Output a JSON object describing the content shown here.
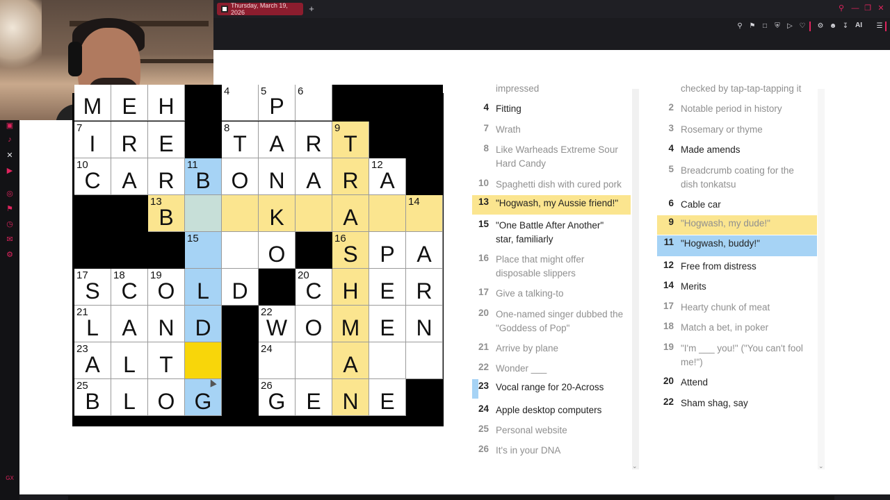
{
  "browser": {
    "tab_title": "Thursday, March 19, 2026",
    "new_tab_symbol": "+",
    "ai_label": "AI",
    "sidebar_icons": [
      "instagram-icon",
      "tiktok-icon",
      "x-icon",
      "youtube-icon",
      "player-icon",
      "pin-icon",
      "clock-icon",
      "chat-icon",
      "settings-icon"
    ],
    "sidebar_footer": "GX",
    "accent_color": "#e0245e"
  },
  "grid": {
    "rows": [
      [
        {
          "l": "M",
          "s": "w"
        },
        {
          "l": "E",
          "s": "w"
        },
        {
          "l": "H",
          "s": "w"
        },
        {
          "s": "b"
        },
        {
          "n": "4",
          "s": "w"
        },
        {
          "n": "5",
          "l": "P",
          "s": "w"
        },
        {
          "n": "6",
          "s": "w"
        },
        {
          "s": "b"
        },
        {
          "s": "b"
        },
        {
          "s": "b"
        }
      ],
      [
        {
          "n": "7",
          "l": "I",
          "s": "w"
        },
        {
          "l": "R",
          "s": "w"
        },
        {
          "l": "E",
          "s": "w"
        },
        {
          "s": "b"
        },
        {
          "n": "8",
          "l": "T",
          "s": "w"
        },
        {
          "l": "A",
          "s": "w"
        },
        {
          "l": "R",
          "s": "w"
        },
        {
          "n": "9",
          "l": "T",
          "s": "y"
        },
        {
          "s": "b"
        },
        {
          "s": "b"
        }
      ],
      [
        {
          "n": "10",
          "l": "C",
          "s": "w"
        },
        {
          "l": "A",
          "s": "w"
        },
        {
          "l": "R",
          "s": "w"
        },
        {
          "n": "11",
          "l": "B",
          "s": "u"
        },
        {
          "l": "O",
          "s": "w"
        },
        {
          "l": "N",
          "s": "w"
        },
        {
          "l": "A",
          "s": "w"
        },
        {
          "l": "R",
          "s": "y"
        },
        {
          "n": "12",
          "l": "A",
          "s": "w"
        },
        {
          "s": "b"
        }
      ],
      [
        {
          "s": "b"
        },
        {
          "s": "b"
        },
        {
          "n": "13",
          "l": "B",
          "s": "y"
        },
        {
          "s": "g"
        },
        {
          "s": "y"
        },
        {
          "l": "K",
          "s": "y"
        },
        {
          "s": "y"
        },
        {
          "l": "A",
          "s": "y"
        },
        {
          "s": "y"
        },
        {
          "n": "14",
          "s": "y"
        }
      ],
      [
        {
          "s": "b"
        },
        {
          "s": "b"
        },
        {
          "s": "b"
        },
        {
          "n": "15",
          "s": "u"
        },
        {
          "s": "w"
        },
        {
          "l": "O",
          "s": "w"
        },
        {
          "s": "b"
        },
        {
          "n": "16",
          "l": "S",
          "s": "y"
        },
        {
          "l": "P",
          "s": "w"
        },
        {
          "l": "A",
          "s": "w"
        }
      ],
      [
        {
          "n": "17",
          "l": "S",
          "s": "w"
        },
        {
          "n": "18",
          "l": "C",
          "s": "w"
        },
        {
          "n": "19",
          "l": "O",
          "s": "w"
        },
        {
          "l": "L",
          "s": "u"
        },
        {
          "l": "D",
          "s": "w"
        },
        {
          "s": "b"
        },
        {
          "n": "20",
          "l": "C",
          "s": "w"
        },
        {
          "l": "H",
          "s": "y"
        },
        {
          "l": "E",
          "s": "w"
        },
        {
          "l": "R",
          "s": "w"
        }
      ],
      [
        {
          "n": "21",
          "l": "L",
          "s": "w"
        },
        {
          "l": "A",
          "s": "w"
        },
        {
          "l": "N",
          "s": "w"
        },
        {
          "l": "D",
          "s": "u"
        },
        {
          "s": "b"
        },
        {
          "n": "22",
          "l": "W",
          "s": "w"
        },
        {
          "l": "O",
          "s": "w"
        },
        {
          "l": "M",
          "s": "y"
        },
        {
          "l": "E",
          "s": "w"
        },
        {
          "l": "N",
          "s": "w"
        }
      ],
      [
        {
          "n": "23",
          "l": "A",
          "s": "w"
        },
        {
          "l": "L",
          "s": "w"
        },
        {
          "l": "T",
          "s": "w"
        },
        {
          "s": "c"
        },
        {
          "s": "b"
        },
        {
          "n": "24",
          "s": "w"
        },
        {
          "s": "w"
        },
        {
          "l": "A",
          "s": "y"
        },
        {
          "s": "w"
        },
        {
          "s": "w"
        }
      ],
      [
        {
          "n": "25",
          "l": "B",
          "s": "w"
        },
        {
          "l": "L",
          "s": "w"
        },
        {
          "l": "O",
          "s": "w"
        },
        {
          "l": "G",
          "s": "u"
        },
        {
          "s": "b"
        },
        {
          "n": "26",
          "l": "G",
          "s": "w"
        },
        {
          "l": "E",
          "s": "w"
        },
        {
          "l": "N",
          "s": "y"
        },
        {
          "l": "E",
          "s": "w"
        },
        {
          "s": "b"
        }
      ]
    ]
  },
  "across": [
    {
      "n": "",
      "t": "impressed",
      "st": "dim"
    },
    {
      "n": "4",
      "t": "Fitting",
      "st": "normal"
    },
    {
      "n": "7",
      "t": "Wrath",
      "st": "dim"
    },
    {
      "n": "8",
      "t": "Like Warheads Extreme Sour Hard Candy",
      "st": "dim"
    },
    {
      "n": "10",
      "t": "Spaghetti dish with cured pork",
      "st": "dim"
    },
    {
      "n": "13",
      "t": "\"Hogwash, my Aussie friend!\"",
      "st": "active"
    },
    {
      "n": "15",
      "t": "\"One Battle After Another\" star, familiarly",
      "st": "normal"
    },
    {
      "n": "16",
      "t": "Place that might offer disposable slippers",
      "st": "dim"
    },
    {
      "n": "17",
      "t": "Give a talking-to",
      "st": "dim"
    },
    {
      "n": "20",
      "t": "One-named singer dubbed the \"Goddess of Pop\"",
      "st": "dim"
    },
    {
      "n": "21",
      "t": "Arrive by plane",
      "st": "dim"
    },
    {
      "n": "22",
      "t": "Wonder ___",
      "st": "dim"
    },
    {
      "n": "23",
      "t": "Vocal range for 20-Across",
      "st": "marked"
    },
    {
      "n": "24",
      "t": "Apple desktop computers",
      "st": "normal"
    },
    {
      "n": "25",
      "t": "Personal website",
      "st": "dim"
    },
    {
      "n": "26",
      "t": "It's in your DNA",
      "st": "dim"
    }
  ],
  "down": [
    {
      "n": "",
      "t": "checked by tap-tap-tapping it",
      "st": "dim"
    },
    {
      "n": "2",
      "t": "Notable period in history",
      "st": "dim"
    },
    {
      "n": "3",
      "t": "Rosemary or thyme",
      "st": "dim"
    },
    {
      "n": "4",
      "t": "Made amends",
      "st": "normal"
    },
    {
      "n": "5",
      "t": "Breadcrumb coating for the dish tonkatsu",
      "st": "dim"
    },
    {
      "n": "6",
      "t": "Cable car",
      "st": "normal"
    },
    {
      "n": "9",
      "t": "\"Hogwash, my dude!\"",
      "st": "active-dim"
    },
    {
      "n": "11",
      "t": "\"Hogwash, buddy!\"",
      "st": "current"
    },
    {
      "n": "12",
      "t": "Free from distress",
      "st": "normal"
    },
    {
      "n": "14",
      "t": "Merits",
      "st": "normal"
    },
    {
      "n": "17",
      "t": "Hearty chunk of meat",
      "st": "dim"
    },
    {
      "n": "18",
      "t": "Match a bet, in poker",
      "st": "dim"
    },
    {
      "n": "19",
      "t": "\"I'm ___ you!\" (\"You can't fool me!\")",
      "st": "dim"
    },
    {
      "n": "20",
      "t": "Attend",
      "st": "normal"
    },
    {
      "n": "22",
      "t": "Sham shag, say",
      "st": "normal"
    }
  ]
}
